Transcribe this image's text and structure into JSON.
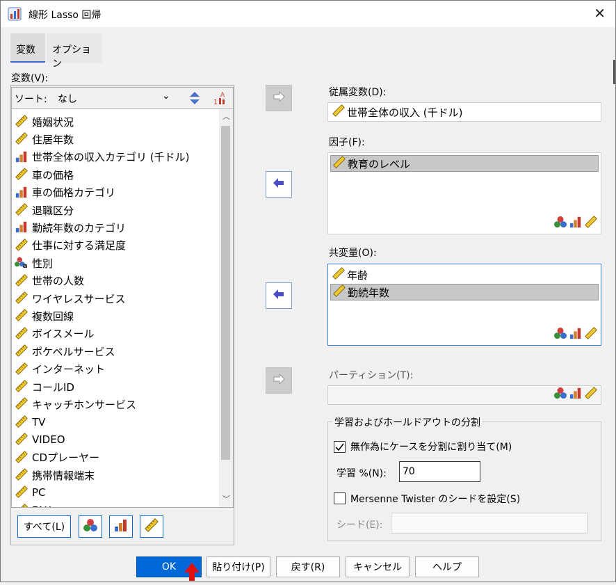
{
  "window": {
    "title": "線形 Lasso 回帰",
    "close_glyph": "✕"
  },
  "tabs": [
    {
      "label": "変数",
      "active": true
    },
    {
      "label": "オプション",
      "active": false
    }
  ],
  "variables_panel": {
    "label": "変数(V):",
    "sort_label": "ソート:",
    "sort_value": "なし",
    "items": [
      {
        "label": "婚姻状況",
        "icon": "scale-icon"
      },
      {
        "label": "住居年数",
        "icon": "scale-icon"
      },
      {
        "label": "世帯全体の収入カテゴリ (千ドル)",
        "icon": "ordinal-icon"
      },
      {
        "label": "車の価格",
        "icon": "scale-icon"
      },
      {
        "label": "車の価格カテゴリ",
        "icon": "ordinal-icon"
      },
      {
        "label": "退職区分",
        "icon": "scale-icon"
      },
      {
        "label": "勤続年数のカテゴリ",
        "icon": "ordinal-icon"
      },
      {
        "label": "仕事に対する満足度",
        "icon": "scale-icon"
      },
      {
        "label": "性別",
        "icon": "nominal-string-icon"
      },
      {
        "label": "世帯の人数",
        "icon": "scale-icon"
      },
      {
        "label": "ワイヤレスサービス",
        "icon": "scale-icon"
      },
      {
        "label": "複数回線",
        "icon": "scale-icon"
      },
      {
        "label": "ボイスメール",
        "icon": "scale-icon"
      },
      {
        "label": "ポケベルサービス",
        "icon": "scale-icon"
      },
      {
        "label": "インターネット",
        "icon": "scale-icon"
      },
      {
        "label": "コールID",
        "icon": "scale-icon"
      },
      {
        "label": "キャッチホンサービス",
        "icon": "scale-icon"
      },
      {
        "label": "TV",
        "icon": "scale-icon"
      },
      {
        "label": "VIDEO",
        "icon": "scale-icon"
      },
      {
        "label": "CDプレーヤー",
        "icon": "scale-icon"
      },
      {
        "label": "携帯情報端末",
        "icon": "scale-icon"
      },
      {
        "label": "PC",
        "icon": "scale-icon"
      },
      {
        "label": "FAX",
        "icon": "scale-icon"
      }
    ],
    "all_button": "すべて(L)"
  },
  "dependent": {
    "label": "従属変数(D):",
    "value": "世帯全体の収入 (千ドル)"
  },
  "factors": {
    "label": "因子(F):",
    "items": [
      "教育のレベル"
    ]
  },
  "covariates": {
    "label": "共変量(O):",
    "items": [
      "年齢",
      "勤続年数"
    ]
  },
  "partition": {
    "label": "パーティション(T):"
  },
  "split_group": {
    "legend": "学習およびホールドアウトの分割",
    "random_assign_label": "無作為にケースを分割に割り当て(M)",
    "random_assign_checked": true,
    "train_pct_label": "学習 %(N):",
    "train_pct_value": "70",
    "mersenne_label": "Mersenne Twister のシードを設定(S)",
    "mersenne_checked": false,
    "seed_label": "シード(E):",
    "seed_value": ""
  },
  "buttons": {
    "ok": "OK",
    "paste": "貼り付け(P)",
    "reset": "戻す(R)",
    "cancel": "キャンセル",
    "help": "ヘルプ"
  }
}
